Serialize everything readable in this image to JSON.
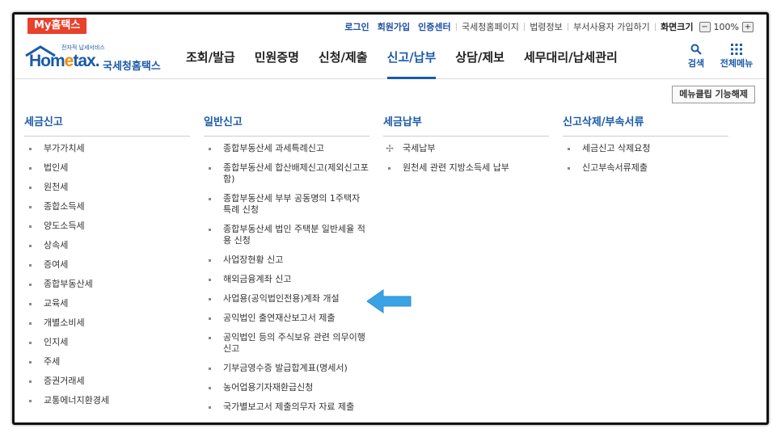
{
  "topbar": {
    "my_hometax": "My홈택스",
    "links": [
      {
        "label": "로그인",
        "style": "blue"
      },
      {
        "label": "회원가입",
        "style": "blue"
      },
      {
        "label": "인증센터",
        "style": "blue"
      },
      {
        "label": "국세청홈페이지",
        "style": "normal"
      },
      {
        "label": "법령정보",
        "style": "normal"
      },
      {
        "label": "부서사용자 가입하기",
        "style": "normal"
      },
      {
        "label": "화면크기",
        "style": "dark"
      }
    ],
    "zoom_minus": "−",
    "zoom_value": "100%",
    "zoom_plus": "+"
  },
  "header": {
    "logo_tagline": "전자적 납세서비스",
    "logo_home": "Hom",
    "logo_e": "e",
    "logo_tax": "tax.",
    "logo_korean": "국세청홈택스",
    "nav": [
      {
        "label": "조회/발급",
        "active": false
      },
      {
        "label": "민원증명",
        "active": false
      },
      {
        "label": "신청/제출",
        "active": false
      },
      {
        "label": "신고/납부",
        "active": true
      },
      {
        "label": "상담/제보",
        "active": false
      },
      {
        "label": "세무대리/납세관리",
        "active": false
      }
    ],
    "search_label": "검색",
    "allmenu_label": "전체메뉴"
  },
  "clip_button": "메뉴클립 기능해제",
  "columns": [
    {
      "title": "세금신고",
      "items": [
        "부가가치세",
        "법인세",
        "원천세",
        "종합소득세",
        "양도소득세",
        "상속세",
        "증여세",
        "종합부동산세",
        "교육세",
        "개별소비세",
        "인지세",
        "주세",
        "증권거래세",
        "교통에너지환경세"
      ]
    },
    {
      "title": "일반신고",
      "items": [
        "종합부동산세 과세특례신고",
        "종합부동산세 합산배제신고(제외신고포함)",
        "종합부동산세 부부 공동명의 1주택자 특례 신청",
        "종합부동산세 법인 주택분 일반세율 적용 신청",
        "사업장현황 신고",
        "해외금융계좌 신고",
        "사업용(공익법인전용)계좌 개설",
        "공익법인 출연재산보고서 제출",
        "공익법인 등의 주식보유 관련 의무이행 신고",
        "기부금영수증 발급합계표(명세서)",
        "농어업용기자재환급신청",
        "국가별보고서 제출의무자 자료 제출"
      ]
    },
    {
      "title": "세금납부",
      "items": [
        "국세납부",
        "원천세 관련 지방소득세 납부"
      ]
    },
    {
      "title": "신고삭제/부속서류",
      "items": [
        "세금신고 삭제요청",
        "신고부속서류제출"
      ]
    }
  ],
  "colors": {
    "accent": "#1a5aa8",
    "brand_red": "#e8412c",
    "logo_orange": "#f08c00",
    "arrow": "#3aa3e6"
  }
}
